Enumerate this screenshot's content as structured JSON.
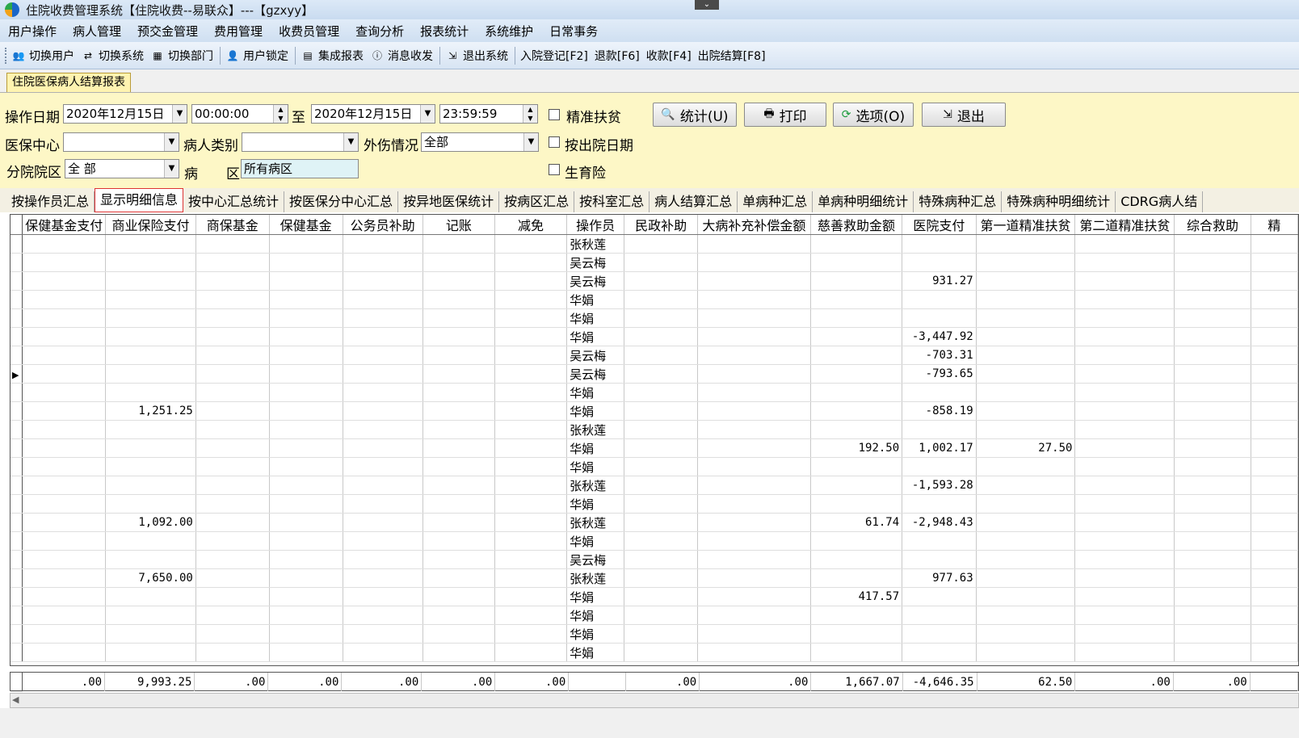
{
  "window": {
    "title": "住院收费管理系统【住院收费--易联众】---【gzxyy】"
  },
  "menu": [
    "用户操作",
    "病人管理",
    "预交金管理",
    "费用管理",
    "收费员管理",
    "查询分析",
    "报表统计",
    "系统维护",
    "日常事务"
  ],
  "toolbar": {
    "switch_user": "切换用户",
    "switch_system": "切换系统",
    "switch_dept": "切换部门",
    "lock_user": "用户锁定",
    "integrated_report": "集成报表",
    "messages": "消息收发",
    "exit_system": "退出系统",
    "admission": "入院登记[F2]",
    "refund": "退款[F6]",
    "collect": "收款[F4]",
    "discharge": "出院结算[F8]"
  },
  "doc_tab": "住院医保病人结算报表",
  "filters": {
    "op_date_label": "操作日期",
    "date_from": "2020年12月15日",
    "time_from": "00:00:00",
    "to_label": "至",
    "date_to": "2020年12月15日",
    "time_to": "23:59:59",
    "precise_poverty": "精准扶贫",
    "insurance_center_label": "医保中心",
    "insurance_center_value": "",
    "patient_type_label": "病人类别",
    "patient_type_value": "",
    "injury_label": "外伤情况",
    "injury_value": "全部",
    "by_discharge_date": "按出院日期",
    "branch_label": "分院院区",
    "branch_value": "全 部",
    "ward_label_1": "病",
    "ward_label_2": "区",
    "ward_value": "所有病区",
    "maternity": "生育险"
  },
  "buttons": {
    "stats": "统计(U)",
    "print": "打印",
    "options": "选项(O)",
    "exit": "退出"
  },
  "report_tabs": [
    "按操作员汇总",
    "显示明细信息",
    "按中心汇总统计",
    "按医保分中心汇总",
    "按异地医保统计",
    "按病区汇总",
    "按科室汇总",
    "病人结算汇总",
    "单病种汇总",
    "单病种明细统计",
    "特殊病种汇总",
    "特殊病种明细统计",
    "CDRG病人结"
  ],
  "active_tab_index": 1,
  "columns": [
    "保健基金支付",
    "商业保险支付",
    "商保基金",
    "保健基金",
    "公务员补助",
    "记账",
    "减免",
    "操作员",
    "民政补助",
    "大病补充补偿金额",
    "慈善救助金额",
    "医院支付",
    "第一道精准扶贫",
    "第二道精准扶贫",
    "综合救助",
    "精"
  ],
  "rows": [
    {
      "operator": "张秋莲",
      "biz": "",
      "charity": "",
      "hospital": "",
      "first": ""
    },
    {
      "operator": "吴云梅",
      "biz": "",
      "charity": "",
      "hospital": "",
      "first": ""
    },
    {
      "operator": "吴云梅",
      "biz": "",
      "charity": "",
      "hospital": "931.27",
      "first": ""
    },
    {
      "operator": "华娟",
      "biz": "",
      "charity": "",
      "hospital": "",
      "first": ""
    },
    {
      "operator": "华娟",
      "biz": "",
      "charity": "",
      "hospital": "",
      "first": ""
    },
    {
      "operator": "华娟",
      "biz": "",
      "charity": "",
      "hospital": "-3,447.92",
      "first": ""
    },
    {
      "operator": "吴云梅",
      "biz": "",
      "charity": "",
      "hospital": "-703.31",
      "first": ""
    },
    {
      "operator": "吴云梅",
      "biz": "",
      "charity": "",
      "hospital": "-793.65",
      "first": ""
    },
    {
      "operator": "华娟",
      "biz": "",
      "charity": "",
      "hospital": "",
      "first": ""
    },
    {
      "operator": "华娟",
      "biz": "1,251.25",
      "charity": "",
      "hospital": "-858.19",
      "first": ""
    },
    {
      "operator": "张秋莲",
      "biz": "",
      "charity": "",
      "hospital": "",
      "first": ""
    },
    {
      "operator": "华娟",
      "biz": "",
      "charity": "192.50",
      "hospital": "1,002.17",
      "first": "27.50"
    },
    {
      "operator": "华娟",
      "biz": "",
      "charity": "",
      "hospital": "",
      "first": ""
    },
    {
      "operator": "张秋莲",
      "biz": "",
      "charity": "",
      "hospital": "-1,593.28",
      "first": ""
    },
    {
      "operator": "华娟",
      "biz": "",
      "charity": "",
      "hospital": "",
      "first": ""
    },
    {
      "operator": "张秋莲",
      "biz": "1,092.00",
      "charity": "61.74",
      "hospital": "-2,948.43",
      "first": ""
    },
    {
      "operator": "华娟",
      "biz": "",
      "charity": "",
      "hospital": "",
      "first": ""
    },
    {
      "operator": "吴云梅",
      "biz": "",
      "charity": "",
      "hospital": "",
      "first": ""
    },
    {
      "operator": "张秋莲",
      "biz": "7,650.00",
      "charity": "",
      "hospital": "977.63",
      "first": ""
    },
    {
      "operator": "华娟",
      "biz": "",
      "charity": "417.57",
      "hospital": "",
      "first": ""
    },
    {
      "operator": "华娟",
      "biz": "",
      "charity": "",
      "hospital": "",
      "first": ""
    },
    {
      "operator": "华娟",
      "biz": "",
      "charity": "",
      "hospital": "",
      "first": ""
    },
    {
      "operator": "华娟",
      "biz": "",
      "charity": "",
      "hospital": "",
      "first": ""
    }
  ],
  "current_row_index": 7,
  "totals": [
    ".00",
    "9,993.25",
    ".00",
    ".00",
    ".00",
    ".00",
    ".00",
    "",
    ".00",
    ".00",
    "1,667.07",
    "-4,646.35",
    "62.50",
    ".00",
    ".00",
    ""
  ]
}
